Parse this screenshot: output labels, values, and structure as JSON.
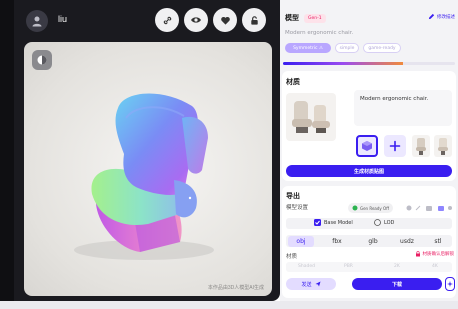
{
  "user": {
    "name": "liu"
  },
  "toolbar": {
    "icons": [
      "link-icon",
      "eye-icon",
      "heart-icon",
      "lock-icon"
    ]
  },
  "viewport": {
    "watermark": "本作品由3D人模型AI生成"
  },
  "model": {
    "title": "模型",
    "badge": "Gen-1",
    "edit_label": "修改描述",
    "description": "Modern ergonomic chair.",
    "tags": [
      "Symmetric ⚠",
      "simple",
      "game-ready"
    ],
    "progress": 0.7
  },
  "material": {
    "title": "材质",
    "prompt_text": "Modern ergonomic chair.",
    "generate_label": "生成材质贴图"
  },
  "export": {
    "title": "导出",
    "model_settings_label": "模型设置",
    "gen_ready_label": "Gen Ready Off",
    "options": [
      "Base Model",
      "LOD"
    ],
    "formats": [
      "obj",
      "fbx",
      "glb",
      "usdz",
      "stl"
    ],
    "material_label": "材质",
    "material_status": "材质确认后解锁",
    "material_options": [
      "Shaded",
      "PBR",
      "2K",
      "4K"
    ],
    "send_label": "发送",
    "download_label": "下载"
  },
  "colors": {
    "accent": "#3a1ef0",
    "brand_pink": "#e91e63",
    "tag_purple": "#b9a7ff"
  }
}
